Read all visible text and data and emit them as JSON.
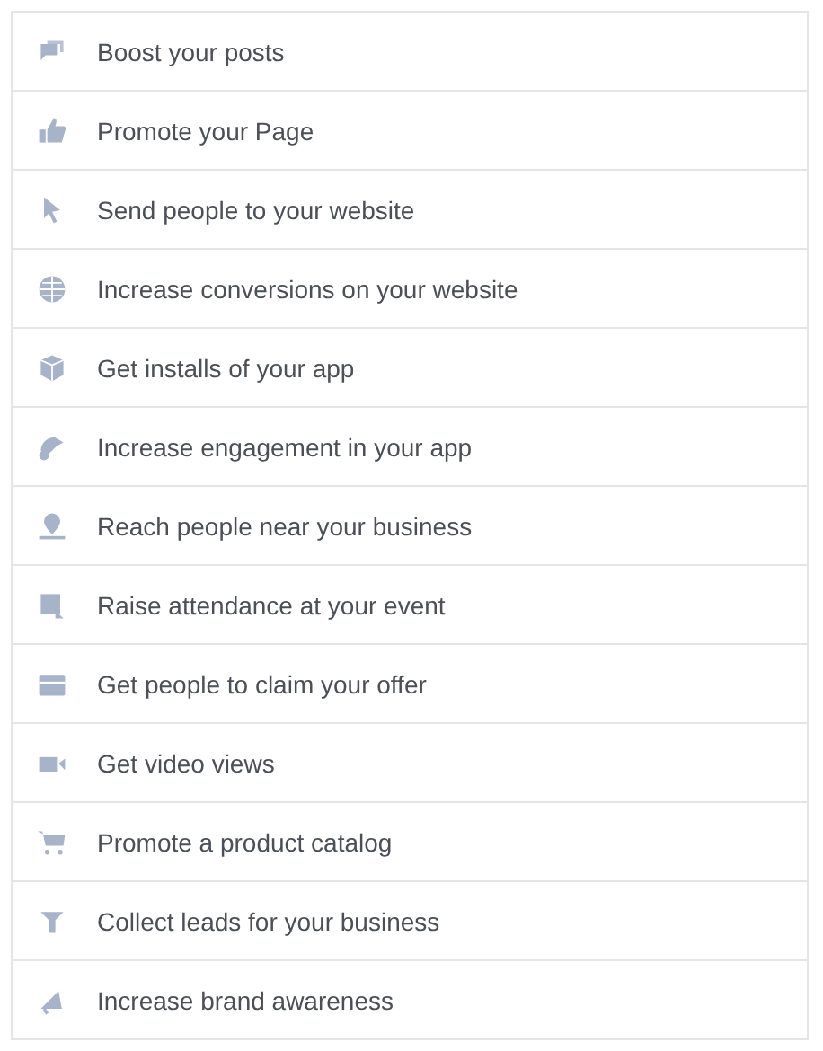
{
  "objectives": [
    {
      "label": "Boost your posts"
    },
    {
      "label": "Promote your Page"
    },
    {
      "label": "Send people to your website"
    },
    {
      "label": "Increase conversions on your website"
    },
    {
      "label": "Get installs of your app"
    },
    {
      "label": "Increase engagement in your app"
    },
    {
      "label": "Reach people near your business"
    },
    {
      "label": "Raise attendance at your event"
    },
    {
      "label": "Get people to claim your offer"
    },
    {
      "label": "Get video views"
    },
    {
      "label": "Promote a product catalog"
    },
    {
      "label": "Collect leads for your business"
    },
    {
      "label": "Increase brand awareness"
    }
  ]
}
